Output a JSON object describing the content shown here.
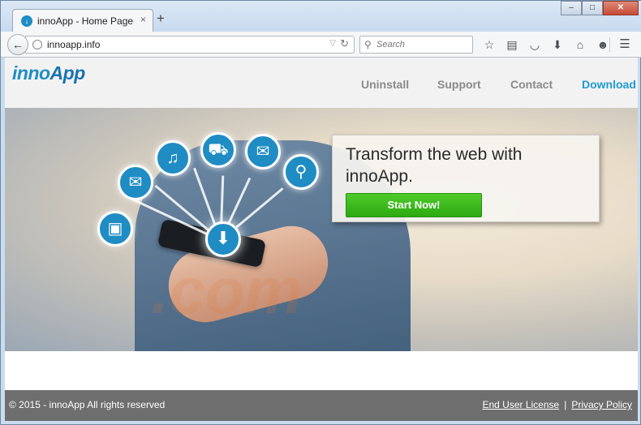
{
  "browser": {
    "tab_title": "innoApp - Home Page",
    "tab_close": "×",
    "new_tab": "+",
    "window_buttons": {
      "minimize": "–",
      "maximize": "□",
      "close": "✕"
    },
    "back": "←",
    "url": "innoapp.info",
    "url_dropdown": "▽",
    "reload": "↻",
    "search_placeholder": "Search",
    "toolbar_icons": [
      "star-icon",
      "reading-list-icon",
      "pocket-icon",
      "download-arrow-icon",
      "home-icon",
      "chat-icon",
      "menu-icon"
    ]
  },
  "site": {
    "logo_part1": "inno",
    "logo_part2": "App",
    "nav": {
      "uninstall": "Uninstall",
      "support": "Support",
      "contact": "Contact",
      "download": "Download"
    },
    "hero": {
      "headline": "Transform the web with innoApp.",
      "cta_label": "Start Now!",
      "icons": [
        "image-icon",
        "chat-icon",
        "music-icon",
        "cart-icon",
        "mail-icon",
        "search-icon",
        "download-icon"
      ]
    },
    "footer": {
      "copyright": "© 2015 - innoApp All rights reserved",
      "eula": "End User License",
      "separator": "|",
      "privacy": "Privacy Policy"
    }
  },
  "colors": {
    "brand_blue": "#1f8dc4",
    "cta_green": "#3bbc1d",
    "footer_gray": "#6e6e6e"
  }
}
